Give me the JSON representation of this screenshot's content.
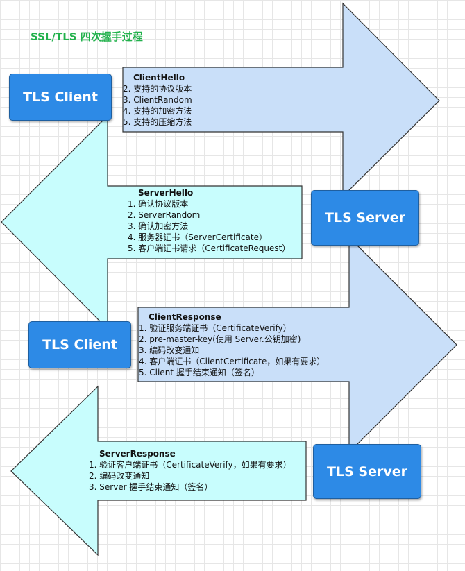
{
  "title": "SSL/TLS 四次握手过程",
  "nodes": {
    "client_1": "TLS Client",
    "server_1": "TLS Server",
    "client_2": "TLS Client",
    "server_2": "TLS Server"
  },
  "messages": {
    "client_hello": {
      "title": "ClientHello",
      "items": [
        "2. 支持的协议版本",
        "3. ClientRandom",
        "4. 支持的加密方法",
        "5. 支持的压缩方法"
      ]
    },
    "server_hello": {
      "title": "ServerHello",
      "items": [
        "1. 确认协议版本",
        "2. ServerRandom",
        "3. 确认加密方法",
        "4. 服务器证书（ServerCertificate）",
        "5. 客户端证书请求（CertificateRequest）"
      ]
    },
    "client_response": {
      "title": "ClientResponse",
      "items": [
        "1. 验证服务端证书（CertificateVerify）",
        "2. pre-master-key(使用 Server.公钥加密)",
        "3. 编码改变通知",
        "4. 客户端证书（ClientCertificate，如果有要求）",
        "5. Client 握手结束通知（签名）"
      ]
    },
    "server_response": {
      "title": "ServerResponse",
      "items": [
        "1. 验证客户端证书（CertificateVerify，如果有要求）",
        "2. 编码改变通知",
        "3. Server 握手结束通知（签名）"
      ]
    }
  },
  "colors": {
    "title": "#22b14c",
    "node_fill": "#2d8ae6",
    "right_arrow_fill": "#c9dff9",
    "left_arrow_fill": "#c8fdfd"
  }
}
